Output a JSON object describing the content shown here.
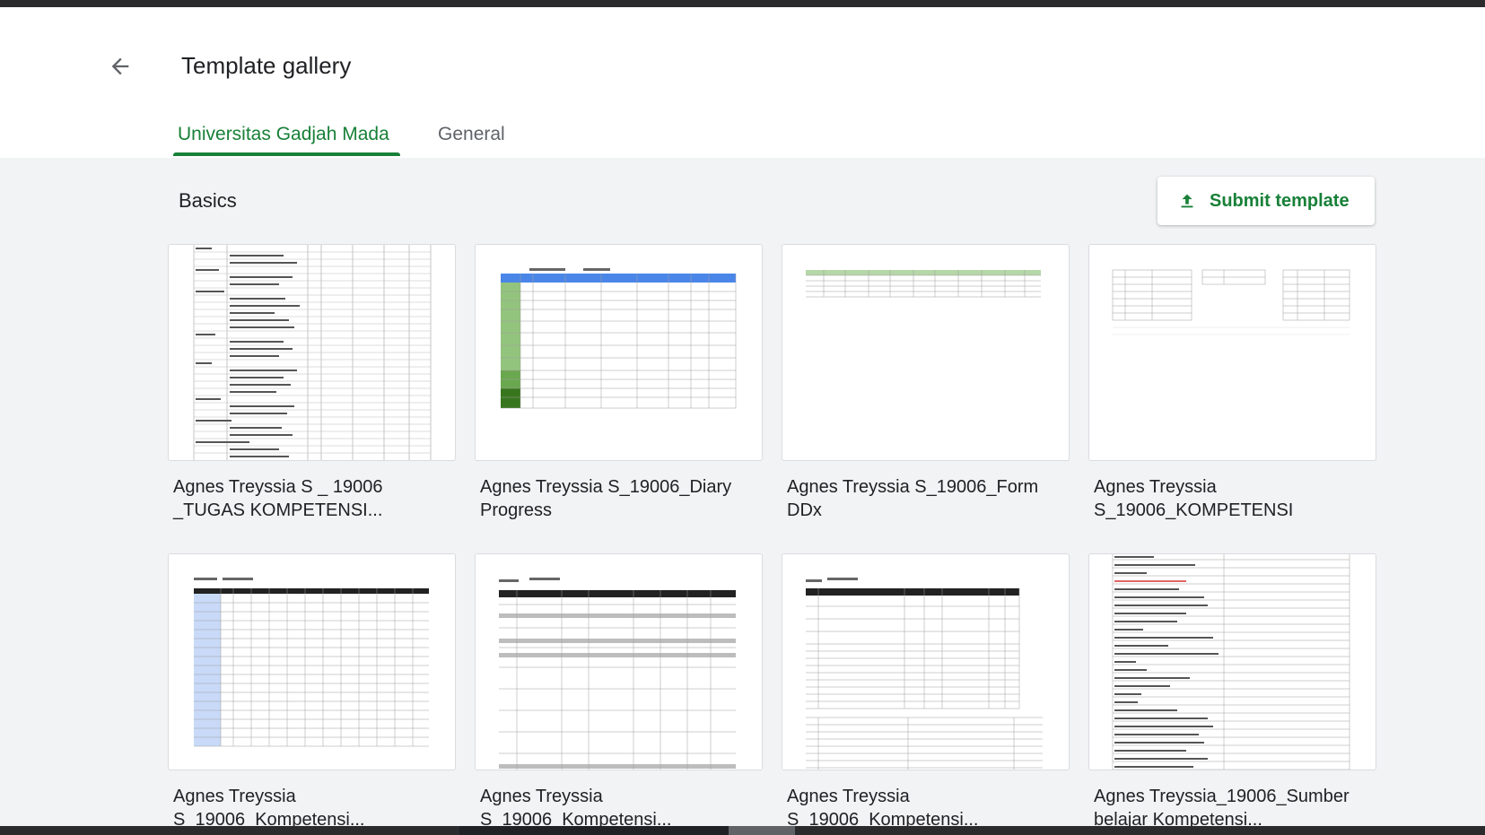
{
  "header": {
    "title": "Template gallery",
    "back_icon": "arrow-back-icon"
  },
  "tabs": [
    {
      "label": "Universitas Gadjah Mada",
      "active": true
    },
    {
      "label": "General",
      "active": false
    }
  ],
  "section": {
    "title": "Basics",
    "submit_label": "Submit template",
    "submit_icon": "upload-icon"
  },
  "colors": {
    "accent": "#188038",
    "header_bg": "#ffffff",
    "page_bg": "#f1f3f4",
    "spreadsheet_header_blue": "#4a86e8",
    "spreadsheet_green": "#6aa84f"
  },
  "templates": [
    {
      "name": "Agnes Treyssia S _ 19006 _TUGAS KOMPETENSI..."
    },
    {
      "name": "Agnes Treyssia S_19006_Diary Progress"
    },
    {
      "name": "Agnes Treyssia S_19006_Form DDx"
    },
    {
      "name": "Agnes Treyssia S_19006_KOMPETENSI"
    },
    {
      "name": "Agnes Treyssia S_19006_Kompetensi..."
    },
    {
      "name": "Agnes Treyssia S_19006_Kompetensi..."
    },
    {
      "name": "Agnes Treyssia S_19006_Kompetensi..."
    },
    {
      "name": "Agnes Treyssia_19006_Sumber belajar Kompetensi..."
    }
  ]
}
